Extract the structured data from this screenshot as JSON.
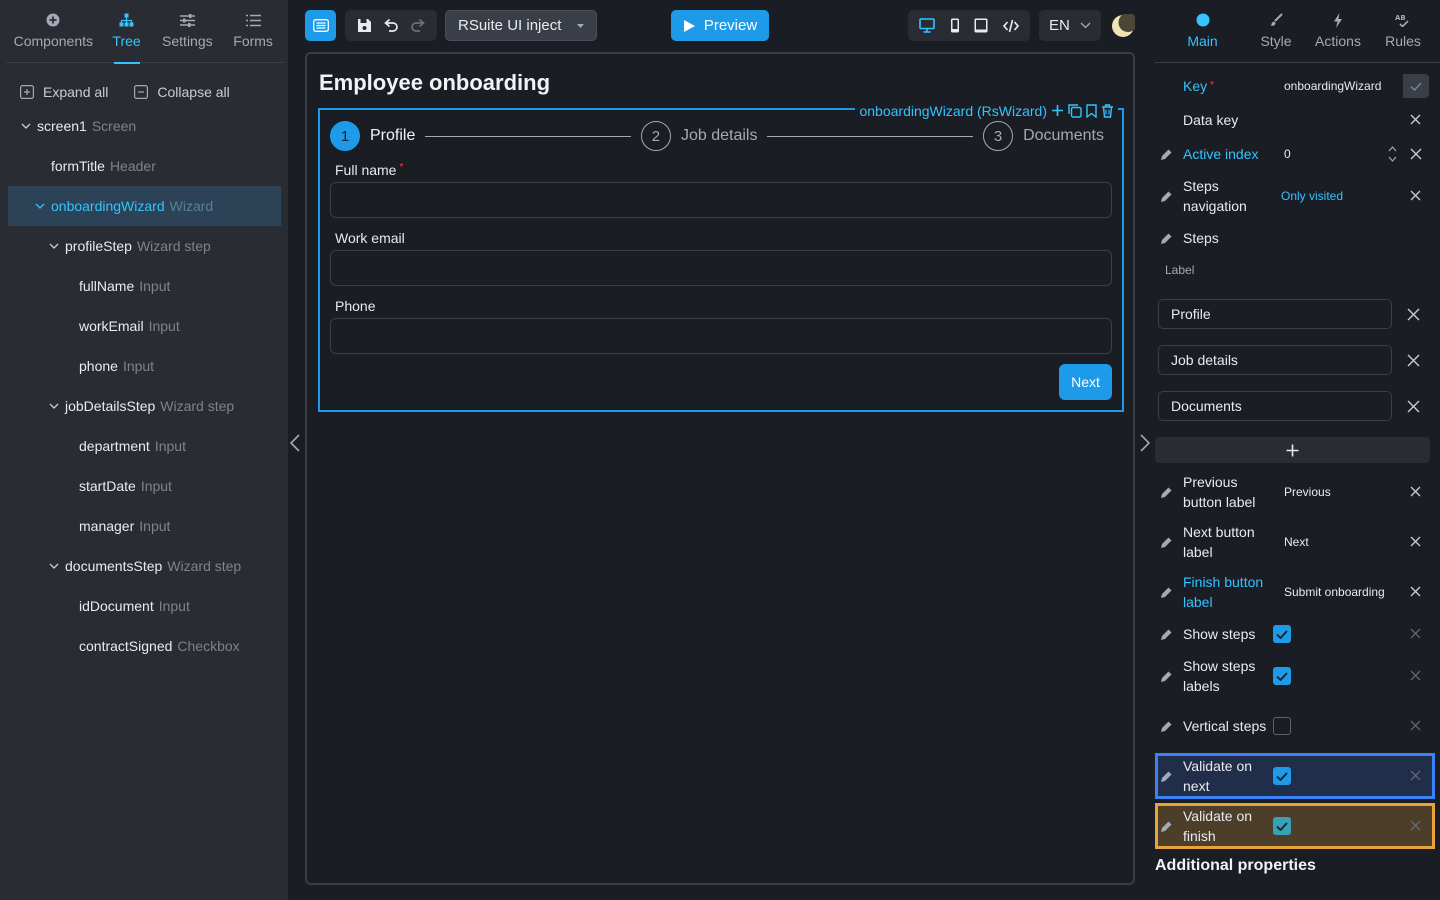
{
  "left_panel": {
    "tabs": [
      {
        "label": "Components",
        "icon": "plus-circle-icon",
        "active": false
      },
      {
        "label": "Tree",
        "icon": "sitemap-icon",
        "active": true
      },
      {
        "label": "Settings",
        "icon": "sliders-icon",
        "active": false
      },
      {
        "label": "Forms",
        "icon": "list-icon",
        "active": false
      }
    ],
    "expand_all": "Expand all",
    "collapse_all": "Collapse all",
    "tree": [
      {
        "name": "screen1",
        "type": "Screen"
      },
      {
        "name": "formTitle",
        "type": "Header"
      },
      {
        "name": "onboardingWizard",
        "type": "Wizard"
      },
      {
        "name": "profileStep",
        "type": "Wizard step"
      },
      {
        "name": "fullName",
        "type": "Input"
      },
      {
        "name": "workEmail",
        "type": "Input"
      },
      {
        "name": "phone",
        "type": "Input"
      },
      {
        "name": "jobDetailsStep",
        "type": "Wizard step"
      },
      {
        "name": "department",
        "type": "Input"
      },
      {
        "name": "startDate",
        "type": "Input"
      },
      {
        "name": "manager",
        "type": "Input"
      },
      {
        "name": "documentsStep",
        "type": "Wizard step"
      },
      {
        "name": "idDocument",
        "type": "Input"
      },
      {
        "name": "contractSigned",
        "type": "Checkbox"
      }
    ]
  },
  "toolbar": {
    "theme_select": "RSuite UI inject",
    "preview_label": "Preview",
    "language": "EN"
  },
  "canvas": {
    "form_title": "Employee onboarding",
    "wizard_tag": "onboardingWizard (RsWizard)",
    "steps": [
      {
        "number": "1",
        "label": "Profile"
      },
      {
        "number": "2",
        "label": "Job details"
      },
      {
        "number": "3",
        "label": "Documents"
      }
    ],
    "fields": [
      {
        "label": "Full name",
        "required": "*"
      },
      {
        "label": "Work email"
      },
      {
        "label": "Phone"
      }
    ],
    "next_label": "Next"
  },
  "right_panel": {
    "tabs": [
      {
        "label": "Main",
        "icon": "circle-icon",
        "active": true
      },
      {
        "label": "Style",
        "icon": "brush-icon",
        "active": false
      },
      {
        "label": "Actions",
        "icon": "bolt-icon",
        "active": false
      },
      {
        "label": "Rules",
        "icon": "rules-icon",
        "active": false
      }
    ],
    "props": {
      "key": {
        "label": "Key",
        "required": "*",
        "value": "onboardingWizard"
      },
      "data_key": {
        "label": "Data key",
        "value": ""
      },
      "active_index": {
        "label": "Active index",
        "value": "0"
      },
      "steps_navigation": {
        "label": "Steps navigation",
        "value": "Only visited"
      },
      "steps": {
        "label": "Steps",
        "sub_label": "Label",
        "items": [
          "Profile",
          "Job details",
          "Documents"
        ]
      },
      "previous_button_label": {
        "label": "Previous button label",
        "value": "Previous"
      },
      "next_button_label": {
        "label": "Next button label",
        "value": "Next"
      },
      "finish_button_label": {
        "label": "Finish button label",
        "value": "Submit onboarding"
      },
      "show_steps": {
        "label": "Show steps",
        "checked": true
      },
      "show_steps_labels": {
        "label": "Show steps labels",
        "checked": true
      },
      "vertical_steps": {
        "label": "Vertical steps",
        "checked": false
      },
      "validate_on_next": {
        "label": "Validate on next",
        "checked": true
      },
      "validate_on_finish": {
        "label": "Validate on finish",
        "checked": true
      }
    },
    "additional_properties": "Additional properties"
  },
  "colors": {
    "accent": "#1e9be8",
    "accent_text": "#34c3ff",
    "highlight_blue": "#3b82f6",
    "highlight_orange": "#e8a23a"
  }
}
